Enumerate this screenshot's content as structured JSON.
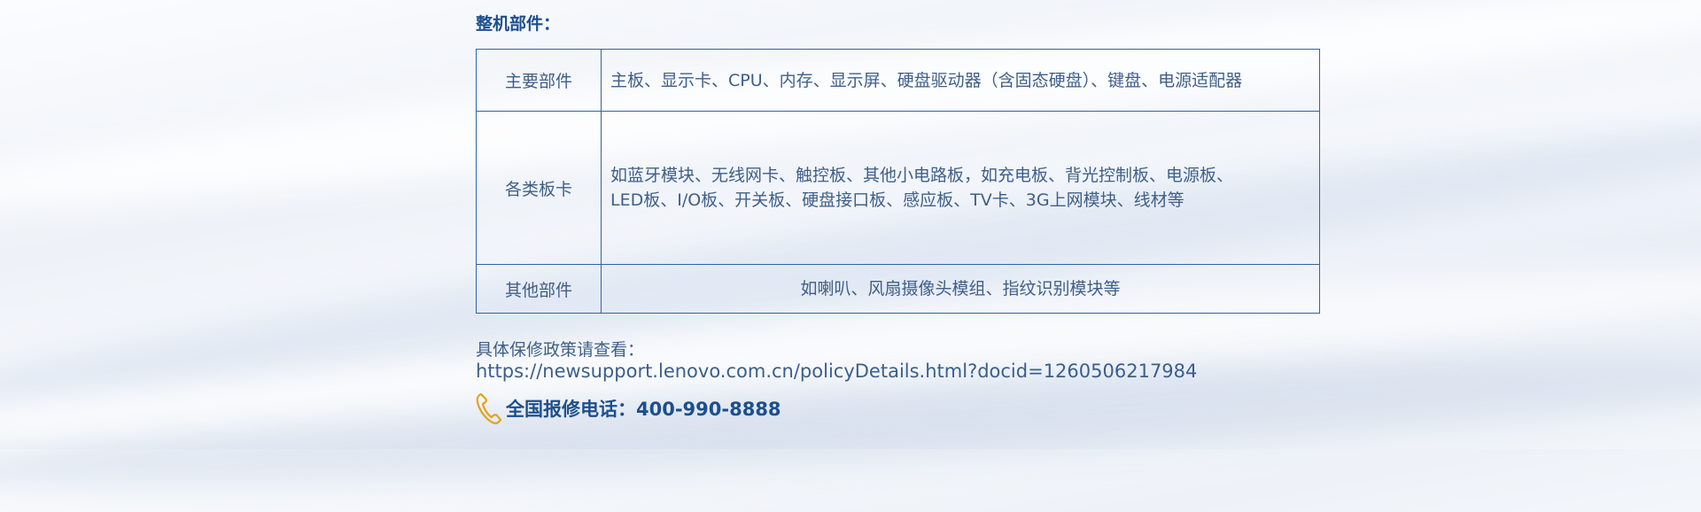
{
  "section_title": "整机部件：",
  "table": {
    "rows": [
      {
        "category": "主要部件",
        "lines": [
          "主板、显示卡、CPU、内存、显示屏、硬盘驱动器（含固态硬盘）、键盘、电源适配器"
        ]
      },
      {
        "category": "各类板卡",
        "lines": [
          "如蓝牙模块、无线网卡、触控板、其他小电路板，如充电板、背光控制板、电源板、",
          "LED板、I/O板、开关板、硬盘接口板、感应板、TV卡、3G上网模块、线材等"
        ]
      },
      {
        "category": "其他部件",
        "lines": [
          "如喇叭、风扇摄像头模组、指纹识别模块等"
        ]
      }
    ]
  },
  "policy": {
    "label": "具体保修政策请查看：",
    "url": "https://newsupport.lenovo.com.cn/policyDetails.html?docid=1260506217984"
  },
  "hotline": {
    "icon": "phone-icon",
    "text": "全国报修电话：400-990-8888",
    "icon_color": "#e3a21a"
  }
}
